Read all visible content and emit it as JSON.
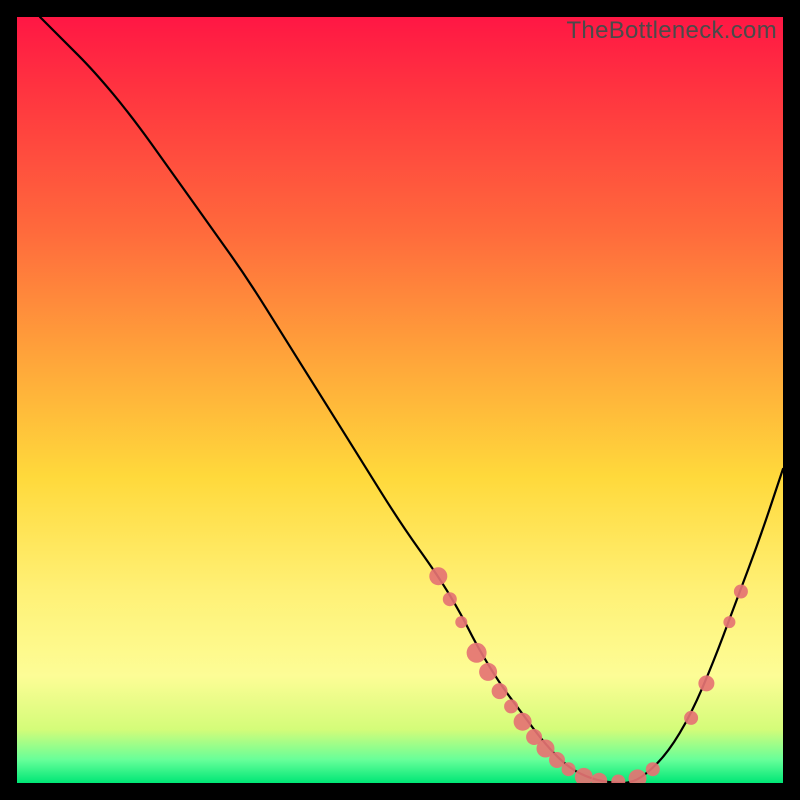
{
  "watermark": "TheBottleneck.com",
  "chart_data": {
    "type": "line",
    "title": "",
    "xlabel": "",
    "ylabel": "",
    "xlim": [
      0,
      100
    ],
    "ylim": [
      0,
      100
    ],
    "series": [
      {
        "name": "bottleneck-curve",
        "x": [
          3,
          6,
          10,
          15,
          20,
          25,
          30,
          35,
          40,
          45,
          50,
          55,
          58,
          60,
          63,
          66,
          69,
          72,
          75,
          78,
          80,
          82,
          85,
          88,
          91,
          94,
          97,
          100
        ],
        "y": [
          100,
          97,
          93,
          87,
          80,
          73,
          66,
          58,
          50,
          42,
          34,
          27,
          22,
          18,
          13,
          9,
          5,
          2,
          0.5,
          0,
          0,
          1,
          4,
          9,
          16,
          24,
          32,
          41
        ]
      }
    ],
    "points": [
      {
        "x": 55,
        "y": 27,
        "r": 9
      },
      {
        "x": 56.5,
        "y": 24,
        "r": 7
      },
      {
        "x": 58,
        "y": 21,
        "r": 6
      },
      {
        "x": 60,
        "y": 17,
        "r": 10
      },
      {
        "x": 61.5,
        "y": 14.5,
        "r": 9
      },
      {
        "x": 63,
        "y": 12,
        "r": 8
      },
      {
        "x": 64.5,
        "y": 10,
        "r": 7
      },
      {
        "x": 66,
        "y": 8,
        "r": 9
      },
      {
        "x": 67.5,
        "y": 6,
        "r": 8
      },
      {
        "x": 69,
        "y": 4.5,
        "r": 9
      },
      {
        "x": 70.5,
        "y": 3,
        "r": 8
      },
      {
        "x": 72,
        "y": 1.8,
        "r": 7
      },
      {
        "x": 74,
        "y": 0.8,
        "r": 9
      },
      {
        "x": 76,
        "y": 0.3,
        "r": 8
      },
      {
        "x": 78.5,
        "y": 0.2,
        "r": 7
      },
      {
        "x": 81,
        "y": 0.6,
        "r": 9
      },
      {
        "x": 83,
        "y": 1.8,
        "r": 7
      },
      {
        "x": 88,
        "y": 8.5,
        "r": 7
      },
      {
        "x": 90,
        "y": 13,
        "r": 8
      },
      {
        "x": 93,
        "y": 21,
        "r": 6
      },
      {
        "x": 94.5,
        "y": 25,
        "r": 7
      }
    ],
    "colors": {
      "curve": "#000000",
      "dots": "#e57373"
    }
  }
}
